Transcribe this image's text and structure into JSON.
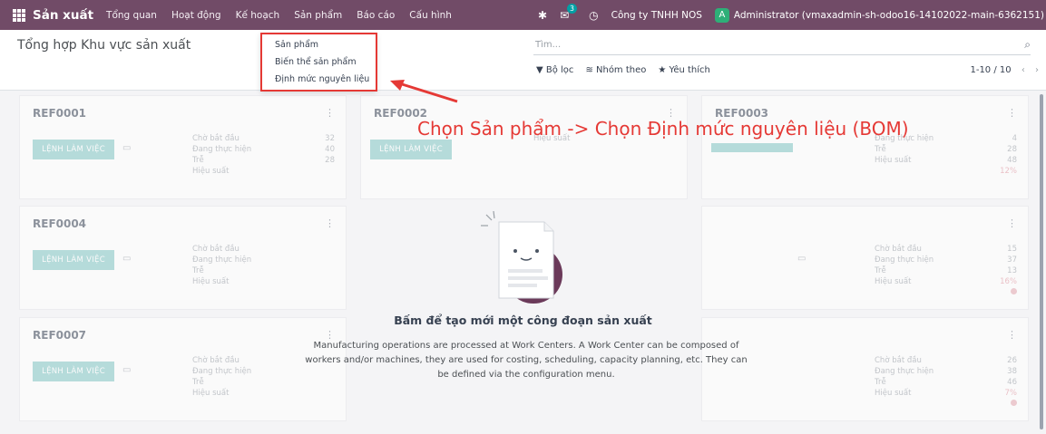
{
  "navbar": {
    "brand": "Sản xuất",
    "menu": [
      "Tổng quan",
      "Hoạt động",
      "Kế hoạch",
      "Sản phẩm",
      "Báo cáo",
      "Cấu hình"
    ],
    "messages_count": "3",
    "company": "Công ty TNHH NOS",
    "avatar_letter": "A",
    "user": "Administrator (vmaxadmin-sh-odoo16-14102022-main-6362151)",
    "color": "#714B67"
  },
  "control_panel": {
    "title": "Tổng hợp Khu vực sản xuất",
    "search_placeholder": "Tìm...",
    "filters": "Bộ lọc",
    "group_by": "Nhóm theo",
    "favorites": "Yêu thích",
    "pager": "1-10 / 10"
  },
  "dropdown": {
    "items": [
      "Sản phẩm",
      "Biến thể sản phẩm",
      "Định mức nguyên liệu"
    ]
  },
  "annotation": "Chọn Sản phẩm -> Chọn Định mức nguyên liệu (BOM)",
  "cards": [
    {
      "ref": "REF0001",
      "button": "LỆNH LÀM VIỆC",
      "labels": [
        "Chờ bắt đầu",
        "Đang thực hiện",
        "Trễ",
        "Hiệu suất"
      ],
      "values": [
        "32",
        "40",
        "28",
        ""
      ]
    },
    {
      "ref": "REF0002",
      "button": "LỆNH LÀM VIỆC",
      "labels": [
        "",
        "",
        "",
        "Hiệu suất"
      ],
      "values": [
        "",
        "",
        "",
        ""
      ]
    },
    {
      "ref": "REF0003",
      "button": "",
      "labels": [
        "",
        "Đang thực hiện",
        "Trễ",
        "Hiệu suất"
      ],
      "values": [
        "4",
        "28",
        "48",
        "12%"
      ]
    },
    {
      "ref": "REF0004",
      "button": "LỆNH LÀM VIỆC",
      "labels": [
        "Chờ bắt đầu",
        "Đang thực hiện",
        "Trễ",
        "Hiệu suất"
      ],
      "values": [
        "",
        "",
        "",
        ""
      ]
    },
    {
      "ref": "",
      "button": "",
      "labels": [
        "Chờ bắt đầu",
        "Đang thực hiện",
        "Trễ",
        "Hiệu suất"
      ],
      "values": [
        "15",
        "37",
        "13",
        "16%"
      ]
    },
    {
      "ref": "REF0007",
      "button": "LỆNH LÀM VIỆC",
      "labels": [
        "Chờ bắt đầu",
        "Đang thực hiện",
        "Trễ",
        "Hiệu suất"
      ],
      "values": [
        "",
        "",
        "",
        ""
      ]
    },
    {
      "ref": "",
      "button": "",
      "labels": [
        "Chờ bắt đầu",
        "Đang thực hiện",
        "Trễ",
        "Hiệu suất"
      ],
      "values": [
        "26",
        "38",
        "46",
        "7%"
      ]
    }
  ],
  "empty_state": {
    "title": "Bấm để tạo mới một công đoạn sản xuất",
    "description": "Manufacturing operations are processed at Work Centers. A Work Center can be composed of workers and/or machines, they are used for costing, scheduling, capacity planning, etc. They can be defined via the configuration menu."
  }
}
